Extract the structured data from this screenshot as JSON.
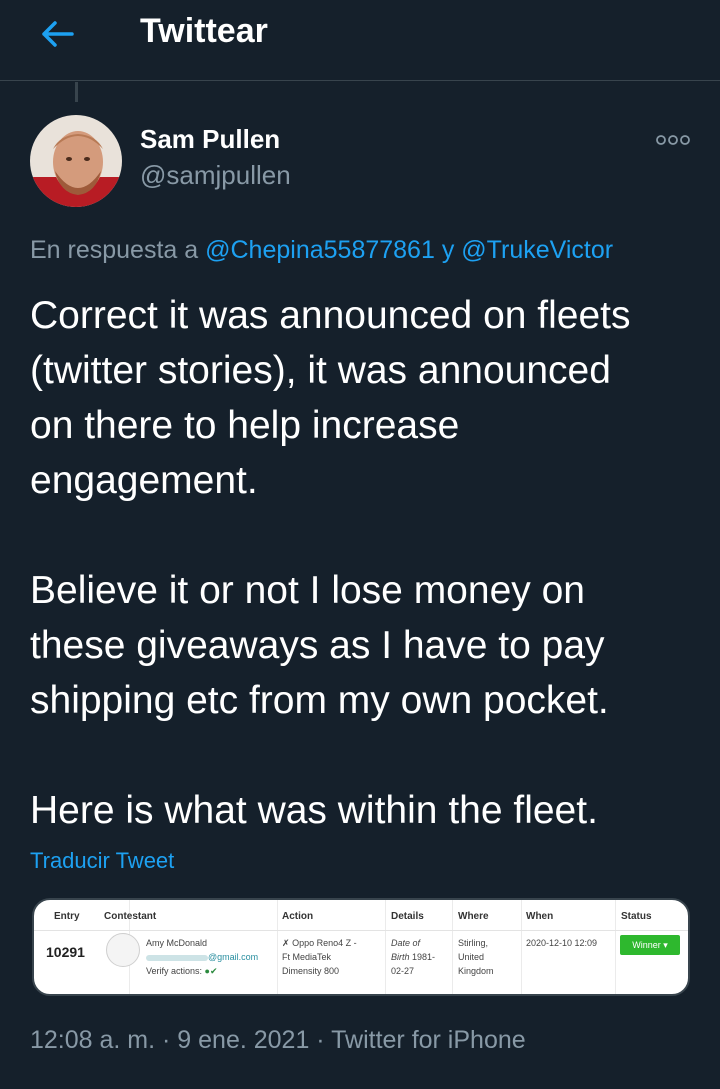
{
  "header": {
    "title": "Twittear",
    "back_icon": "arrow-left-icon"
  },
  "tweet": {
    "author_name": "Sam Pullen",
    "author_handle": "@samjpullen",
    "reply_prefix": "En respuesta a ",
    "mention_1": "@Chepina55877861",
    "reply_join": " y ",
    "mention_2": "@TrukeVictor",
    "text_lines": [
      "Correct it was announced on fleets",
      "(twitter stories), it was announced",
      "on there to help increase",
      "engagement.",
      "",
      "Believe it or not I lose money on",
      "these giveaways as I have to pay",
      "shipping etc from my own pocket.",
      "",
      "Here is what was within the fleet."
    ],
    "translate_label": "Traducir Tweet",
    "timestamp": "12:08 a. m. · 9 ene. 2021 · Twitter for iPhone"
  },
  "media_table": {
    "headers": {
      "entry": "Entry",
      "contestant": "Contestant",
      "action": "Action",
      "details": "Details",
      "where": "Where",
      "when": "When",
      "status": "Status"
    },
    "row": {
      "entry": "10291",
      "contestant_name": "Amy McDonald",
      "email_domain": "@gmail.com",
      "verify_label": "Verify actions:",
      "action_1": "Oppo Reno4 Z -",
      "action_2": "Ft MediaTek",
      "action_3": "Dimensity 800",
      "details_1": "Date of",
      "details_2": "Birth",
      "details_2b": "1981-",
      "details_3": "02-27",
      "where_1": "Stirling,",
      "where_2": "United",
      "where_3": "Kingdom",
      "when": "2020-12-10 12:09",
      "status": "Winner ▾"
    }
  },
  "colors": {
    "background": "#15202b",
    "accent": "#1da1f2",
    "muted": "#8899a6",
    "border": "#38444d",
    "winner": "#2eb82e"
  }
}
